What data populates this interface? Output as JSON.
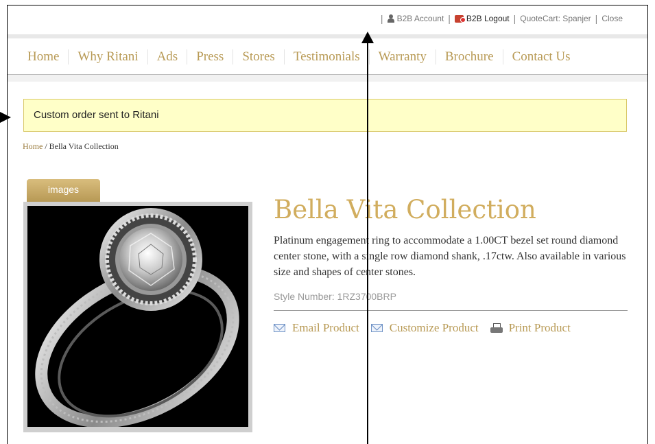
{
  "topbar": {
    "account": "B2B Account",
    "logout": "B2B Logout",
    "quotecart": "QuoteCart: Spanjer",
    "close": "Close"
  },
  "nav": {
    "items": [
      "Home",
      "Why Ritani",
      "Ads",
      "Press",
      "Stores",
      "Testimonials",
      "Warranty",
      "Brochure",
      "Contact Us"
    ]
  },
  "message": "Custom order sent to Ritani",
  "breadcrumb": {
    "home": "Home",
    "separator": " / ",
    "current": "Bella Vita Collection"
  },
  "images_tab": "images",
  "product": {
    "title": "Bella Vita Collection",
    "description": "Platinum engagement ring to accommodate a 1.00CT bezel set round diamond center stone, with a single row diamond shank, .17ctw. Also available in various size and shapes of center stones.",
    "style_number": "Style Number: 1RZ3700BRP",
    "actions": {
      "email": "Email Product",
      "customize": "Customize Product",
      "print": "Print Product"
    }
  },
  "colors": {
    "gold": "#b89a55",
    "title_gold": "#d1ad5e",
    "message_bg": "#ffffc8"
  }
}
